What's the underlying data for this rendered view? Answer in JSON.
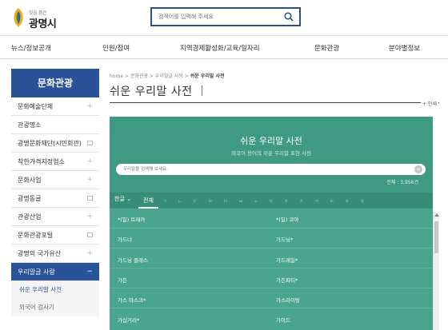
{
  "header": {
    "logo_sub": "빛을 품은",
    "logo_title": "광명시",
    "search_placeholder": "검색어를 입력해 주세요",
    "search_icon": "search-icon"
  },
  "gnb": [
    "뉴스/정보공개",
    "민원/참여",
    "지역경제활성화/교육/일자리",
    "문화관광",
    "분야별정보"
  ],
  "lnb": {
    "title": "문화관광",
    "items": [
      {
        "label": "문화예술단체",
        "mark": "+"
      },
      {
        "label": "관광명소",
        "mark": ""
      },
      {
        "label": "광명문화재단(시민회관)",
        "mark": "window"
      },
      {
        "label": "착한가격지정업소",
        "mark": "+"
      },
      {
        "label": "문화사업",
        "mark": "+"
      },
      {
        "label": "광명동굴",
        "mark": "window"
      },
      {
        "label": "관광산업",
        "mark": "+"
      },
      {
        "label": "문화관광포털",
        "mark": "window"
      },
      {
        "label": "광명의 국가유산",
        "mark": "+"
      },
      {
        "label": "우리말글 사랑",
        "mark": "−"
      }
    ],
    "sub_items": [
      "쉬운 우리말 사전",
      "외국어 검사기"
    ]
  },
  "breadcrumb": {
    "home": "home",
    "sep": ">",
    "level1": "문화관광",
    "level2": "우리말글 사랑",
    "current": "쉬운 우리말 사전"
  },
  "page_title": "쉬운 우리말 사전",
  "util_label": "+ 인쇄",
  "dict": {
    "title": "쉬운 우리말 사전",
    "subtitle": "외국어 용어의 쉬운 우리말 표현 사전",
    "search_placeholder": "우리말을 검색해 보세요.",
    "clear": "×",
    "count": "전체 : 3,956건",
    "lang_tab": "한글",
    "all_tab": "전체",
    "consonants": [
      "ㄱ",
      "ㄴ",
      "ㄷ",
      "ㄹ",
      "ㅁ",
      "ㅂ",
      "ㅅ",
      "ㅇ",
      "ㅈ",
      "ㅊ",
      "ㅋ",
      "ㅌ",
      "ㅍ",
      "ㅎ"
    ],
    "words": [
      [
        "*(일) 트레카",
        "*(일) 코아"
      ],
      [
        "가드너",
        "가드닝*"
      ],
      [
        "가드닝 클래스",
        "가드레일*"
      ],
      [
        "가든",
        "가든파티*"
      ],
      [
        "가스 마스크*",
        "가스라이팅"
      ],
      [
        "가십거리*",
        "가이드"
      ]
    ]
  }
}
